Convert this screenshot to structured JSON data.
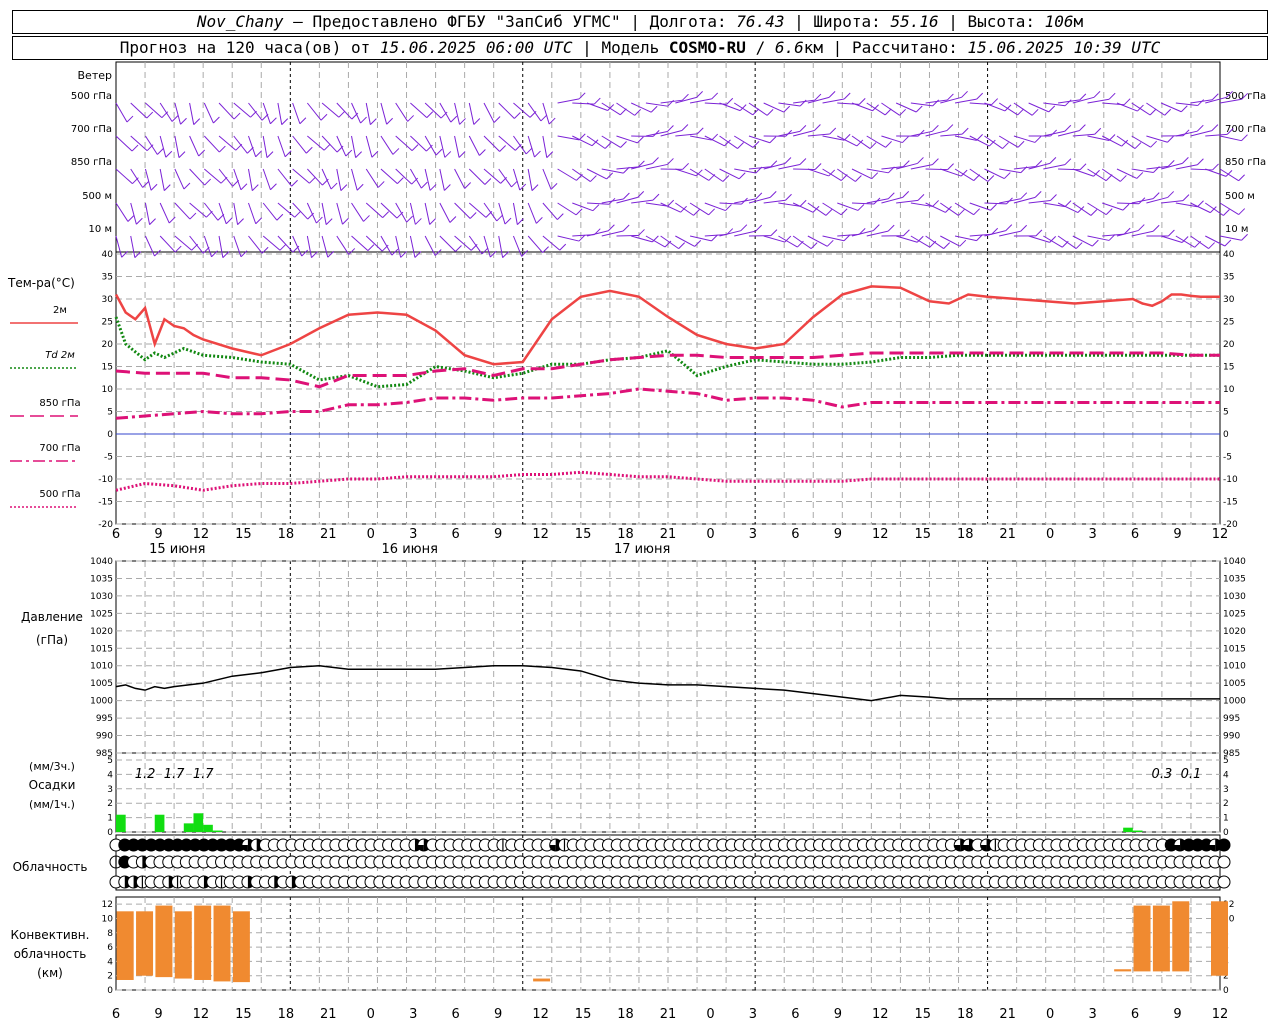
{
  "header": {
    "station": "Nov_Chany",
    "provider": "– Предоставлено ФГБУ \"ЗапСиб УГМС\"",
    "lon_label": "| Долгота:",
    "lon": "76.43",
    "lat_label": "| Широта:",
    "lat": "55.16",
    "alt_label": "| Высота:",
    "alt": "106",
    "alt_unit": "м",
    "forecast_label": "Прогноз на 120 часа(ов) от",
    "forecast_start": "15.06.2025 06:00 UTC",
    "model_label": "| Модель",
    "model": "COSMO-RU",
    "res_sep": "/",
    "res": "6.6",
    "res_unit": "км",
    "calc_label": "| Рассчитано:",
    "calc_time": "15.06.2025 10:39 UTC"
  },
  "hour_ticks": [
    "6",
    "9",
    "12",
    "15",
    "18",
    "21",
    "0",
    "3",
    "6",
    "9",
    "12",
    "15",
    "18",
    "21",
    "0",
    "3",
    "6",
    "9",
    "12",
    "15",
    "18",
    "21",
    "0",
    "3",
    "6",
    "9",
    "12"
  ],
  "day_labels": [
    {
      "label": "15 июня",
      "hour": 6
    },
    {
      "label": "16 июня",
      "hour": 30
    },
    {
      "label": "17 июня",
      "hour": 54
    }
  ],
  "wind_panel": {
    "label": "Ветер",
    "levels": [
      "500 гПа",
      "700 гПа",
      "850 гПа",
      "500 м",
      "10  м"
    ],
    "series_color": "#7b22d6"
  },
  "temp_panel": {
    "label": "Тем-ра(°С)",
    "legend": [
      {
        "name": "2м",
        "color": "#ee4444",
        "style": "solid"
      },
      {
        "name": "Td 2м",
        "color": "#118811",
        "style": "dotted"
      },
      {
        "name": "850 гПа",
        "color": "#dd1177",
        "style": "longdash"
      },
      {
        "name": "700 гПа",
        "color": "#dd1177",
        "style": "dashdot"
      },
      {
        "name": "500 гПа",
        "color": "#dd1177",
        "style": "dotted"
      }
    ]
  },
  "pressure_panel": {
    "label": "Давление",
    "unit": "(гПа)"
  },
  "precip_panel": {
    "label": "Осадки",
    "unit_3h": "(мм/3ч.)",
    "unit_1h": "(мм/1ч.)",
    "totals": [
      {
        "text": "1.2",
        "hour": 3
      },
      {
        "text": "1.7",
        "hour": 6
      },
      {
        "text": "1.7",
        "hour": 9
      },
      {
        "text": "0.3",
        "hour": 108
      },
      {
        "text": "0.1",
        "hour": 111
      }
    ]
  },
  "cloud_panel": {
    "label": "Облачность"
  },
  "conv_panel": {
    "label_lines": [
      "Конвективн.",
      "облачность",
      "(км)"
    ]
  },
  "chart_data": [
    {
      "type": "line",
      "title": "Тем-ра(°С)",
      "ylim": [
        -20,
        40
      ],
      "yticks": [
        -20,
        -15,
        -10,
        -5,
        0,
        5,
        10,
        15,
        20,
        25,
        30,
        35,
        40
      ],
      "x_unit": "hours from 15.06.2025 06:00 UTC",
      "series": [
        {
          "name": "2м",
          "x": [
            0,
            1,
            2,
            3,
            4,
            5,
            6,
            7,
            8,
            9,
            12,
            15,
            18,
            21,
            24,
            27,
            30,
            33,
            36,
            39,
            42,
            45,
            48,
            51,
            54,
            57,
            60,
            63,
            66,
            69,
            72,
            75,
            78,
            81,
            84,
            86,
            87,
            88,
            90,
            93,
            96,
            99,
            102,
            105,
            106,
            107,
            108,
            109,
            110,
            111,
            112,
            113,
            114
          ],
          "y": [
            31,
            27,
            25.5,
            28,
            20,
            25.5,
            24,
            23.5,
            22,
            21,
            19,
            17.5,
            20,
            23.5,
            26.5,
            27,
            26.5,
            23,
            17.5,
            15.5,
            16,
            25.5,
            30.5,
            31.8,
            30.5,
            26,
            22,
            20,
            19,
            20,
            26,
            31,
            32.8,
            32.5,
            29.5,
            29,
            30,
            31,
            30.5,
            30,
            29.5,
            29,
            29.5,
            30,
            29,
            28.5,
            29.5,
            31,
            31,
            30.7,
            30.5,
            30.5,
            30.5
          ]
        },
        {
          "name": "Td 2м",
          "x": [
            0,
            1,
            3,
            4,
            5,
            7,
            9,
            12,
            15,
            18,
            21,
            24,
            27,
            30,
            33,
            36,
            39,
            42,
            45,
            48,
            51,
            54,
            57,
            60,
            63,
            66,
            69,
            72,
            75,
            78,
            81,
            84,
            87,
            90,
            93,
            96,
            99,
            102,
            105,
            108,
            111,
            114
          ],
          "y": [
            26,
            20,
            16.5,
            18,
            17,
            19,
            17.5,
            17,
            16,
            15.5,
            12,
            13,
            10.5,
            11,
            15,
            14,
            12.5,
            13.5,
            15.5,
            15.5,
            16.5,
            17,
            18.5,
            13,
            15,
            16.5,
            16,
            15.5,
            15.5,
            16,
            17,
            17,
            17.5,
            17.5,
            17.5,
            17.5,
            17.5,
            17.5,
            17.5,
            17.5,
            17.5,
            17.5
          ]
        },
        {
          "name": "850 гПа",
          "x": [
            0,
            3,
            6,
            9,
            12,
            15,
            18,
            21,
            24,
            27,
            30,
            33,
            36,
            39,
            42,
            45,
            48,
            51,
            54,
            57,
            60,
            63,
            66,
            69,
            72,
            75,
            78,
            81,
            84,
            87,
            90,
            93,
            96,
            99,
            102,
            105,
            108,
            111,
            114
          ],
          "y": [
            14,
            13.5,
            13.5,
            13.5,
            12.5,
            12.5,
            12,
            10.5,
            13,
            13,
            13,
            14,
            14.5,
            13,
            14.5,
            14.5,
            15.5,
            16.5,
            17,
            17.5,
            17.5,
            17,
            17,
            17,
            17,
            17.5,
            18,
            18,
            18,
            18,
            18,
            18,
            18,
            18,
            18,
            18,
            18,
            17.5,
            17.5
          ]
        },
        {
          "name": "700 гПа",
          "x": [
            0,
            3,
            6,
            9,
            12,
            15,
            18,
            21,
            24,
            27,
            30,
            33,
            36,
            39,
            42,
            45,
            48,
            51,
            54,
            57,
            60,
            63,
            66,
            69,
            72,
            75,
            78,
            81,
            84,
            87,
            90,
            93,
            96,
            99,
            102,
            105,
            108,
            111,
            114
          ],
          "y": [
            3.5,
            4,
            4.5,
            5,
            4.5,
            4.5,
            5,
            5,
            6.5,
            6.5,
            7,
            8,
            8,
            7.5,
            8,
            8,
            8.5,
            9,
            10,
            9.5,
            9,
            7.5,
            8,
            8,
            7.5,
            6,
            7,
            7,
            7,
            7,
            7,
            7,
            7,
            7,
            7,
            7,
            7,
            7,
            7
          ]
        },
        {
          "name": "500 гПа",
          "x": [
            0,
            3,
            6,
            9,
            12,
            15,
            18,
            21,
            24,
            27,
            30,
            33,
            36,
            39,
            42,
            45,
            48,
            51,
            54,
            57,
            60,
            63,
            66,
            69,
            72,
            75,
            78,
            81,
            84,
            87,
            90,
            93,
            96,
            99,
            102,
            105,
            108,
            111,
            114
          ],
          "y": [
            -12.5,
            -11,
            -11.5,
            -12.5,
            -11.5,
            -11,
            -11,
            -10.5,
            -10,
            -10,
            -9.5,
            -9.5,
            -9.5,
            -9.5,
            -9,
            -9,
            -8.5,
            -9,
            -9.5,
            -9.5,
            -10,
            -10.5,
            -10.5,
            -10.5,
            -10.5,
            -10.5,
            -10,
            -10,
            -10,
            -10,
            -10,
            -10,
            -10,
            -10,
            -10,
            -10,
            -10,
            -10,
            -10
          ]
        }
      ]
    },
    {
      "type": "line",
      "title": "Давление",
      "ylabel": "(гПа)",
      "ylim": [
        985,
        1040
      ],
      "yticks": [
        985,
        990,
        995,
        1000,
        1005,
        1010,
        1015,
        1020,
        1025,
        1030,
        1035,
        1040
      ],
      "series": [
        {
          "name": "Давление",
          "x": [
            0,
            1,
            2,
            3,
            4,
            5,
            6,
            9,
            12,
            15,
            18,
            21,
            24,
            27,
            30,
            33,
            36,
            39,
            42,
            45,
            48,
            51,
            54,
            57,
            60,
            63,
            66,
            69,
            72,
            75,
            78,
            81,
            84,
            86,
            87,
            88,
            90,
            93,
            96,
            99,
            102,
            105,
            108,
            111,
            114
          ],
          "y": [
            1004,
            1004.5,
            1003.5,
            1003,
            1004,
            1003.5,
            1004,
            1005,
            1007,
            1008,
            1009.5,
            1010,
            1009,
            1009,
            1009,
            1009,
            1009.5,
            1010,
            1010,
            1009.5,
            1008.5,
            1006,
            1005,
            1004.5,
            1004.5,
            1004,
            1003.5,
            1003,
            1002,
            1001,
            1000,
            1001.5,
            1001,
            1000.5,
            1000.5,
            1000.5,
            1000.5,
            1000.5,
            1000.5,
            1000.5,
            1000.5,
            1000.5,
            1000.5,
            1000.5,
            1000.5
          ]
        }
      ]
    },
    {
      "type": "bar",
      "title": "Осадки",
      "ylabel": "(мм/1ч.)",
      "ylim": [
        0,
        5
      ],
      "yticks": [
        0,
        1,
        2,
        3,
        4,
        5
      ],
      "color": "#11dd11",
      "x": [
        0,
        4,
        7,
        8,
        9,
        10,
        104,
        105
      ],
      "values": [
        1.2,
        1.2,
        0.6,
        1.3,
        0.5,
        0.1,
        0.3,
        0.1
      ]
    },
    {
      "type": "table",
      "title": "Облачность",
      "rows_desc": "top/middle/low cloud cover per hour (0 empty .. 4 full)",
      "rows": [
        [
          0,
          4,
          4,
          4,
          4,
          4,
          4,
          4,
          4,
          4,
          4,
          4,
          4,
          4,
          4,
          3,
          2,
          0,
          0,
          0,
          0,
          0,
          0,
          0,
          0,
          0,
          0,
          0,
          0,
          0,
          0,
          0,
          0,
          0,
          2,
          3,
          0,
          0,
          0,
          0,
          0,
          0,
          0,
          0,
          1,
          0,
          0,
          0,
          0,
          0,
          3,
          1,
          0,
          0,
          0,
          0,
          0,
          0,
          0,
          0,
          0,
          0,
          0,
          0,
          0,
          0,
          0,
          0,
          0,
          0,
          0,
          0,
          0,
          0,
          0,
          0,
          0,
          0,
          0,
          0,
          0,
          0,
          0,
          0,
          0,
          0,
          0,
          0,
          0,
          0,
          0,
          0,
          0,
          0,
          0,
          0,
          3,
          3,
          0,
          3,
          1,
          0,
          0,
          0,
          0,
          0,
          0,
          0,
          0,
          0,
          0,
          0,
          0,
          0,
          0,
          0,
          0,
          0,
          0,
          0,
          4,
          3,
          4,
          4,
          4,
          3,
          4
        ],
        [
          1,
          4,
          0,
          2,
          0,
          0,
          0,
          0,
          0,
          0,
          0,
          0,
          0,
          0,
          0,
          0,
          0,
          0,
          0,
          0,
          0,
          0,
          0,
          0,
          0,
          0,
          0,
          0,
          0,
          0,
          0,
          0,
          0,
          0,
          0,
          0,
          0,
          0,
          0,
          0,
          0,
          0,
          0,
          0,
          0,
          0,
          0,
          0,
          0,
          0,
          0,
          0,
          0,
          0,
          0,
          0,
          0,
          0,
          0,
          0,
          0,
          0,
          0,
          0,
          0,
          0,
          0,
          0,
          0,
          0,
          0,
          0,
          0,
          0,
          0,
          0,
          0,
          0,
          0,
          0,
          0,
          0,
          0,
          0,
          0,
          0,
          0,
          0,
          0,
          0,
          0,
          0,
          0,
          0,
          0,
          0,
          0,
          0,
          0,
          0,
          0,
          0,
          0,
          0,
          0,
          0,
          0,
          0,
          0,
          0,
          0,
          0,
          0,
          0,
          0,
          0,
          0,
          0,
          0,
          0,
          0,
          0,
          0,
          0,
          0,
          0,
          0
        ],
        [
          0,
          2,
          2,
          1,
          0,
          0,
          2,
          1,
          0,
          0,
          2,
          0,
          1,
          0,
          0,
          2,
          0,
          0,
          2,
          0,
          2,
          0,
          0,
          0,
          0,
          0,
          0,
          0,
          0,
          0,
          0,
          0,
          0,
          0,
          0,
          0,
          0,
          0,
          0,
          0,
          0,
          0,
          0,
          0,
          0,
          0,
          0,
          0,
          0,
          0,
          0,
          0,
          0,
          0,
          0,
          0,
          0,
          0,
          0,
          0,
          0,
          0,
          0,
          0,
          0,
          0,
          0,
          0,
          0,
          0,
          0,
          0,
          0,
          0,
          0,
          0,
          0,
          0,
          0,
          0,
          0,
          0,
          0,
          0,
          0,
          0,
          0,
          0,
          0,
          0,
          0,
          0,
          0,
          0,
          0,
          0,
          0,
          0,
          0,
          0,
          0,
          0,
          0,
          0,
          0,
          0,
          0,
          0,
          0,
          0,
          0,
          0,
          0,
          0,
          0,
          0,
          0,
          0,
          0,
          0,
          0,
          0,
          0,
          0,
          0,
          0,
          0
        ]
      ]
    },
    {
      "type": "bar",
      "title": "Конвективн. облачность (км)",
      "ylim": [
        0,
        13
      ],
      "yticks": [
        0,
        2,
        4,
        6,
        8,
        10,
        12
      ],
      "color": "#f08a30",
      "x": [
        1,
        3,
        5,
        7,
        9,
        11,
        13,
        44,
        104,
        106,
        108,
        110,
        114
      ],
      "base": [
        1.4,
        2,
        1.8,
        1.6,
        1.4,
        1.2,
        1.1,
        1.2,
        2.6,
        2.6,
        2.6,
        2.6,
        2
      ],
      "top": [
        11,
        11,
        11.8,
        11,
        11.8,
        11.8,
        11,
        1.6,
        2.9,
        11.8,
        11.8,
        12.4,
        12.4
      ]
    }
  ]
}
